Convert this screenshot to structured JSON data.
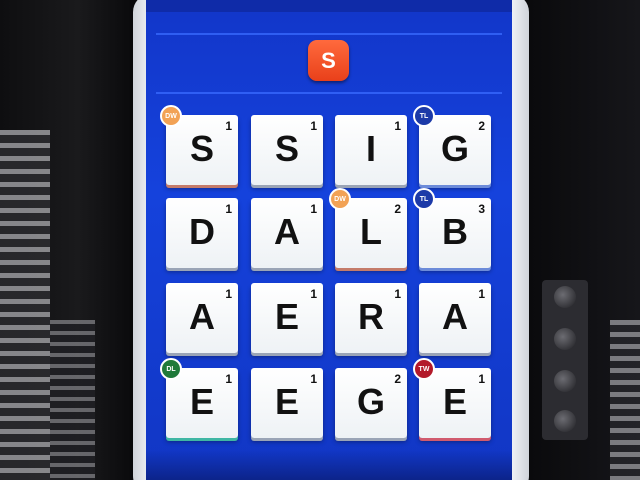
{
  "game": {
    "current_letter": "S",
    "accent_color": "#e9401a",
    "board_color": "#1542dc"
  },
  "board": {
    "rows": [
      [
        {
          "letter": "S",
          "points": "1",
          "bonus": "DW"
        },
        {
          "letter": "S",
          "points": "1",
          "bonus": ""
        },
        {
          "letter": "I",
          "points": "1",
          "bonus": ""
        },
        {
          "letter": "G",
          "points": "2",
          "bonus": "TL"
        }
      ],
      [
        {
          "letter": "D",
          "points": "1",
          "bonus": ""
        },
        {
          "letter": "A",
          "points": "1",
          "bonus": ""
        },
        {
          "letter": "L",
          "points": "2",
          "bonus": "DW"
        },
        {
          "letter": "B",
          "points": "3",
          "bonus": "TL"
        }
      ],
      [
        {
          "letter": "A",
          "points": "1",
          "bonus": ""
        },
        {
          "letter": "E",
          "points": "1",
          "bonus": ""
        },
        {
          "letter": "R",
          "points": "1",
          "bonus": ""
        },
        {
          "letter": "A",
          "points": "1",
          "bonus": ""
        }
      ],
      [
        {
          "letter": "E",
          "points": "1",
          "bonus": "DL"
        },
        {
          "letter": "E",
          "points": "1",
          "bonus": ""
        },
        {
          "letter": "G",
          "points": "2",
          "bonus": ""
        },
        {
          "letter": "E",
          "points": "1",
          "bonus": "TW"
        }
      ]
    ]
  }
}
